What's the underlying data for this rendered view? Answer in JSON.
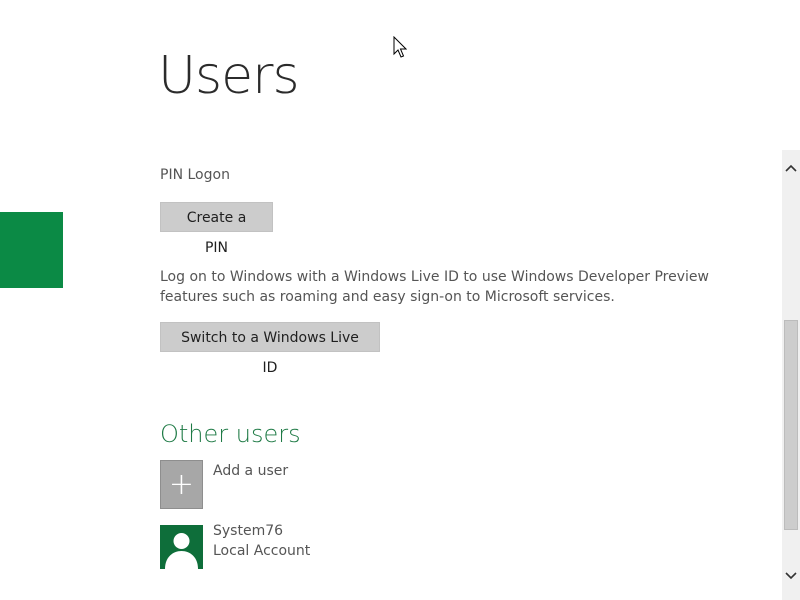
{
  "page": {
    "title": "Users"
  },
  "pin": {
    "label": "PIN Logon",
    "button_label": "Create a PIN"
  },
  "live_id": {
    "description": "Log on to Windows with a Windows Live ID to use Windows Developer Preview features such as roaming and easy sign-on to Microsoft services.",
    "button_label": "Switch to a Windows Live ID"
  },
  "other_users": {
    "heading": "Other users",
    "add_user": {
      "icon": "plus-icon",
      "label": "Add a user"
    },
    "users": [
      {
        "name": "System76",
        "account_type": "Local Account",
        "icon": "person-icon"
      }
    ]
  },
  "colors": {
    "accent_green": "#0b8a45",
    "heading_green": "#1e7a45",
    "avatar_bg": "#0e6e3a",
    "button_bg": "#cccccc"
  }
}
